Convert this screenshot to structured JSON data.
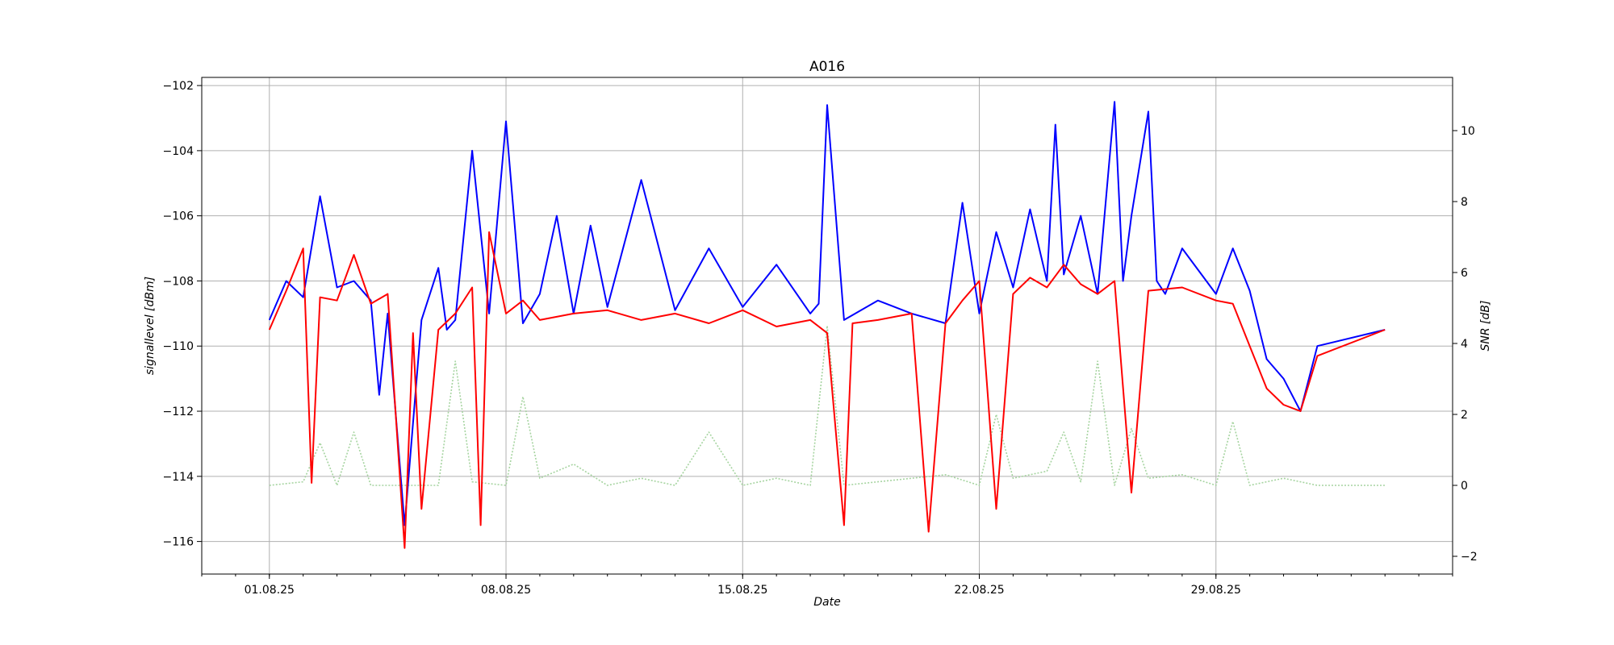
{
  "chart_data": {
    "type": "line",
    "title": "A016",
    "xlabel": "Date",
    "ylabel_left": "signallevel [dBm]",
    "ylabel_right": "SNR [dB]",
    "x_ticks": [
      "01.08.25",
      "08.08.25",
      "15.08.25",
      "22.08.25",
      "29.08.25"
    ],
    "x_range_days": [
      "30.07.25",
      "05.09.25"
    ],
    "ylim_left": [
      -117.0,
      -101.75
    ],
    "ylim_right": [
      -2.5,
      11.5
    ],
    "yticks_left": [
      -102,
      -104,
      -106,
      -108,
      -110,
      -112,
      -114,
      -116
    ],
    "yticks_right": [
      -2,
      0,
      2,
      4,
      6,
      8,
      10
    ],
    "grid": true,
    "series": [
      {
        "axis": "left",
        "color": "#0000ff",
        "style": "solid",
        "x_dates": [
          "01.08.25",
          "01.08.25 12:00",
          "02.08.25",
          "02.08.25 12:00",
          "03.08.25",
          "03.08.25 12:00",
          "04.08.25",
          "04.08.25 06:00",
          "04.08.25 12:00",
          "05.08.25",
          "05.08.25 12:00",
          "06.08.25",
          "06.08.25 06:00",
          "06.08.25 12:00",
          "07.08.25",
          "07.08.25 12:00",
          "08.08.25",
          "08.08.25 12:00",
          "09.08.25",
          "09.08.25 12:00",
          "10.08.25",
          "10.08.25 12:00",
          "11.08.25",
          "12.08.25",
          "13.08.25",
          "14.08.25",
          "15.08.25",
          "16.08.25",
          "17.08.25",
          "17.08.25 06:00",
          "17.08.25 12:00",
          "18.08.25",
          "19.08.25",
          "20.08.25",
          "21.08.25",
          "21.08.25 12:00",
          "22.08.25",
          "22.08.25 12:00",
          "23.08.25",
          "23.08.25 12:00",
          "24.08.25",
          "24.08.25 06:00",
          "24.08.25 12:00",
          "25.08.25",
          "25.08.25 12:00",
          "26.08.25",
          "26.08.25 06:00",
          "26.08.25 12:00",
          "27.08.25",
          "27.08.25 06:00",
          "27.08.25 12:00",
          "28.08.25",
          "29.08.25",
          "29.08.25 12:00",
          "30.08.25",
          "30.08.25 12:00",
          "31.08.25",
          "31.08.25 12:00",
          "01.09.25",
          "03.09.25"
        ],
        "values": [
          -109.2,
          -108.0,
          -108.5,
          -105.4,
          -108.2,
          -108.0,
          -108.6,
          -111.5,
          -109.0,
          -115.5,
          -109.2,
          -107.6,
          -109.5,
          -109.2,
          -104.0,
          -109.0,
          -103.1,
          -109.3,
          -108.4,
          -106.0,
          -109.0,
          -106.3,
          -108.8,
          -104.9,
          -108.9,
          -107.0,
          -108.8,
          -107.5,
          -109.0,
          -108.7,
          -102.6,
          -109.2,
          -108.6,
          -109.0,
          -109.3,
          -105.6,
          -109.0,
          -106.5,
          -108.2,
          -105.8,
          -108.0,
          -103.2,
          -107.8,
          -106.0,
          -108.4,
          -102.5,
          -108.0,
          -106.0,
          -102.8,
          -108.0,
          -108.4,
          -107.0,
          -108.4,
          -107.0,
          -108.3,
          -110.4,
          -111.0,
          -112.0,
          -110.0,
          -109.5
        ]
      },
      {
        "axis": "left",
        "color": "#ff0000",
        "style": "solid",
        "x_dates": [
          "01.08.25",
          "01.08.25 12:00",
          "02.08.25",
          "02.08.25 06:00",
          "02.08.25 12:00",
          "03.08.25",
          "03.08.25 12:00",
          "04.08.25",
          "04.08.25 12:00",
          "05.08.25",
          "05.08.25 06:00",
          "05.08.25 12:00",
          "06.08.25",
          "06.08.25 12:00",
          "07.08.25",
          "07.08.25 06:00",
          "07.08.25 12:00",
          "08.08.25",
          "08.08.25 12:00",
          "09.08.25",
          "10.08.25",
          "11.08.25",
          "12.08.25",
          "13.08.25",
          "14.08.25",
          "15.08.25",
          "16.08.25",
          "17.08.25",
          "17.08.25 12:00",
          "18.08.25",
          "18.08.25 06:00",
          "19.08.25",
          "20.08.25",
          "20.08.25 12:00",
          "21.08.25",
          "21.08.25 12:00",
          "22.08.25",
          "22.08.25 12:00",
          "23.08.25",
          "23.08.25 12:00",
          "24.08.25",
          "24.08.25 12:00",
          "25.08.25",
          "25.08.25 12:00",
          "26.08.25",
          "26.08.25 12:00",
          "27.08.25",
          "28.08.25",
          "29.08.25",
          "29.08.25 12:00",
          "30.08.25",
          "30.08.25 12:00",
          "31.08.25",
          "31.08.25 12:00",
          "01.09.25",
          "03.09.25"
        ],
        "values": [
          -109.5,
          -108.3,
          -107.0,
          -114.2,
          -108.5,
          -108.6,
          -107.2,
          -108.7,
          -108.4,
          -116.2,
          -109.6,
          -115.0,
          -109.5,
          -109.0,
          -108.2,
          -115.5,
          -106.5,
          -109.0,
          -108.6,
          -109.2,
          -109.0,
          -108.9,
          -109.2,
          -109.0,
          -109.3,
          -108.9,
          -109.4,
          -109.2,
          -109.6,
          -115.5,
          -109.3,
          -109.2,
          -109.0,
          -115.7,
          -109.3,
          -108.6,
          -108.0,
          -115.0,
          -108.4,
          -107.9,
          -108.2,
          -107.5,
          -108.1,
          -108.4,
          -108.0,
          -114.5,
          -108.3,
          -108.2,
          -108.6,
          -108.7,
          -110.0,
          -111.3,
          -111.8,
          -112.0,
          -110.3,
          -109.5
        ]
      },
      {
        "axis": "right",
        "color": "#a6d4a0",
        "style": "dotted",
        "x_dates": [
          "01.08.25",
          "02.08.25",
          "02.08.25 12:00",
          "03.08.25",
          "03.08.25 12:00",
          "04.08.25",
          "05.08.25",
          "06.08.25",
          "06.08.25 12:00",
          "07.08.25",
          "08.08.25",
          "08.08.25 12:00",
          "09.08.25",
          "10.08.25",
          "11.08.25",
          "12.08.25",
          "13.08.25",
          "14.08.25",
          "15.08.25",
          "16.08.25",
          "17.08.25",
          "17.08.25 12:00",
          "18.08.25",
          "19.08.25",
          "20.08.25",
          "21.08.25",
          "22.08.25",
          "22.08.25 12:00",
          "23.08.25",
          "24.08.25",
          "24.08.25 12:00",
          "25.08.25",
          "25.08.25 12:00",
          "26.08.25",
          "26.08.25 12:00",
          "27.08.25",
          "28.08.25",
          "29.08.25",
          "29.08.25 12:00",
          "30.08.25",
          "31.08.25",
          "01.09.25",
          "03.09.25"
        ],
        "values": [
          0.0,
          0.1,
          1.2,
          0.0,
          1.5,
          0.0,
          0.0,
          0.0,
          3.5,
          0.1,
          0.0,
          2.5,
          0.2,
          0.6,
          0.0,
          0.2,
          0.0,
          1.5,
          0.0,
          0.2,
          0.0,
          4.5,
          0.0,
          0.1,
          0.2,
          0.3,
          0.0,
          2.0,
          0.2,
          0.4,
          1.5,
          0.1,
          3.5,
          0.0,
          1.6,
          0.2,
          0.3,
          0.0,
          1.8,
          0.0,
          0.2,
          0.0,
          0.0
        ]
      }
    ]
  }
}
